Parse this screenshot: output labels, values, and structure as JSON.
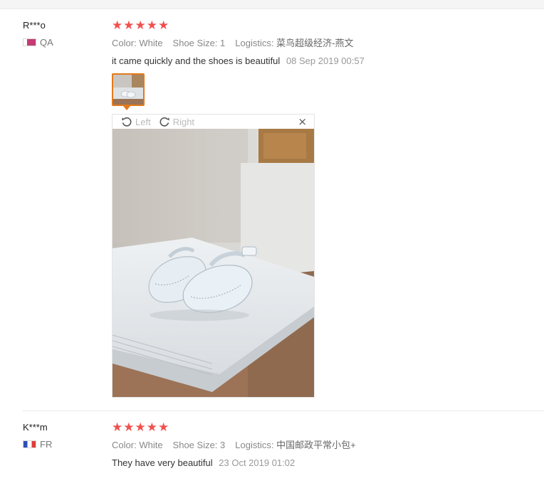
{
  "reviews": [
    {
      "user": "R***o",
      "country": "QA",
      "stars": 5,
      "attributes": [
        {
          "name": "Color:",
          "value": "White"
        },
        {
          "name": "Shoe Size:",
          "value": "1"
        },
        {
          "name": "Logistics:",
          "value": "菜鸟超级经济-燕文"
        }
      ],
      "text": "it came quickly and the shoes is beautiful",
      "date": "08 Sep 2019 00:57",
      "viewer": {
        "rotate_left": "Left",
        "rotate_right": "Right",
        "close": "×"
      }
    },
    {
      "user": "K***m",
      "country": "FR",
      "stars": 5,
      "attributes": [
        {
          "name": "Color:",
          "value": "White"
        },
        {
          "name": "Shoe Size:",
          "value": "3"
        },
        {
          "name": "Logistics:",
          "value": "中国邮政平常小包+"
        }
      ],
      "text": "They have very beautiful",
      "date": "23 Oct 2019 01:02"
    }
  ],
  "colors": {
    "star": "#f0504f",
    "thumb_border": "#e27a1c"
  },
  "icons": [
    "star-icon",
    "rotate-left-icon",
    "rotate-right-icon",
    "close-icon",
    "flag-icon"
  ]
}
